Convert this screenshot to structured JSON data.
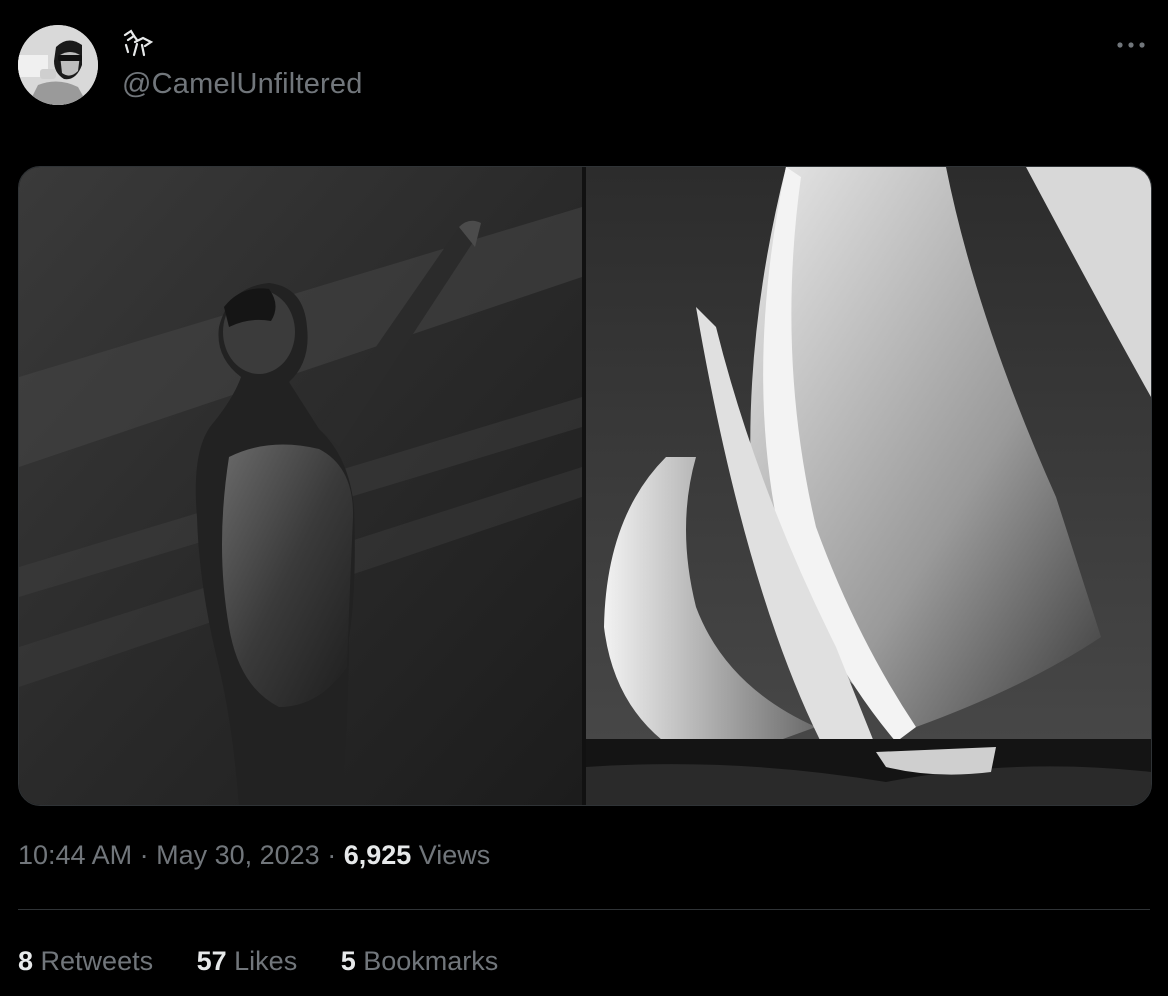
{
  "tweet": {
    "author": {
      "handle": "@CamelUnfiltered",
      "display_name_icon": "camel-glyph-icon",
      "avatar": "avatar-photo"
    },
    "more_icon": "more-dots-icon",
    "media": [
      {
        "name": "photo-woman-in-shadow"
      },
      {
        "name": "photo-sailboat-spinnakers"
      }
    ],
    "meta": {
      "time": "10:44 AM",
      "sep1": " · ",
      "date": "May 30, 2023",
      "sep2": " · ",
      "views_count": "6,925",
      "views_label": " Views"
    },
    "stats": {
      "retweets": {
        "count": "8",
        "label": " Retweets"
      },
      "likes": {
        "count": "57",
        "label": " Likes"
      },
      "bookmarks": {
        "count": "5",
        "label": " Bookmarks"
      }
    }
  },
  "colors": {
    "background": "#000000",
    "text_primary": "#e7e9ea",
    "text_secondary": "#71767b",
    "divider": "#2f3336"
  }
}
